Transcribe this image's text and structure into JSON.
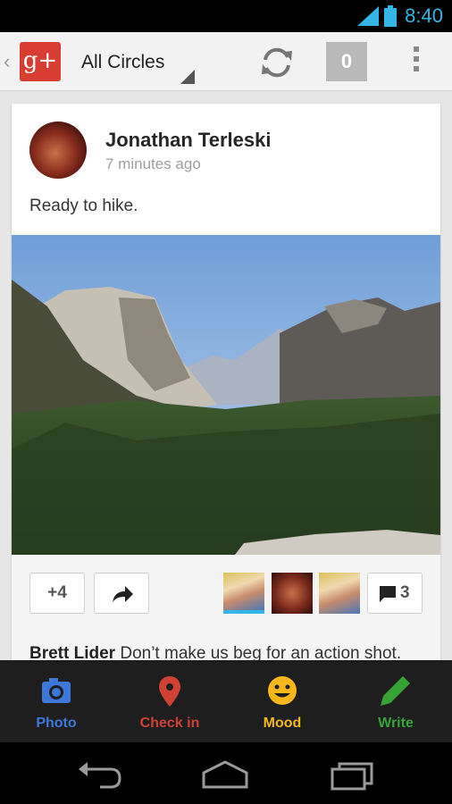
{
  "status_bar": {
    "time": "8:40"
  },
  "action_bar": {
    "logo_text": "g+",
    "circle_selector": "All Circles",
    "notification_count": "0"
  },
  "post": {
    "author": "Jonathan Terleski",
    "timestamp": "7 minutes ago",
    "text": "Ready to hike.",
    "plus_one_label": "+4",
    "comment_count": "3",
    "comment_author": "Brett Lider",
    "comment_text": "Don’t make us beg for an action shot."
  },
  "tray": {
    "photo": "Photo",
    "checkin": "Check in",
    "mood": "Mood",
    "write": "Write"
  },
  "colors": {
    "accent": "#33b5e5",
    "gplus_red": "#d73d32",
    "photo_blue": "#3d78d8",
    "checkin_red": "#d04135",
    "mood_yellow": "#f5b719",
    "write_green": "#36a335"
  }
}
